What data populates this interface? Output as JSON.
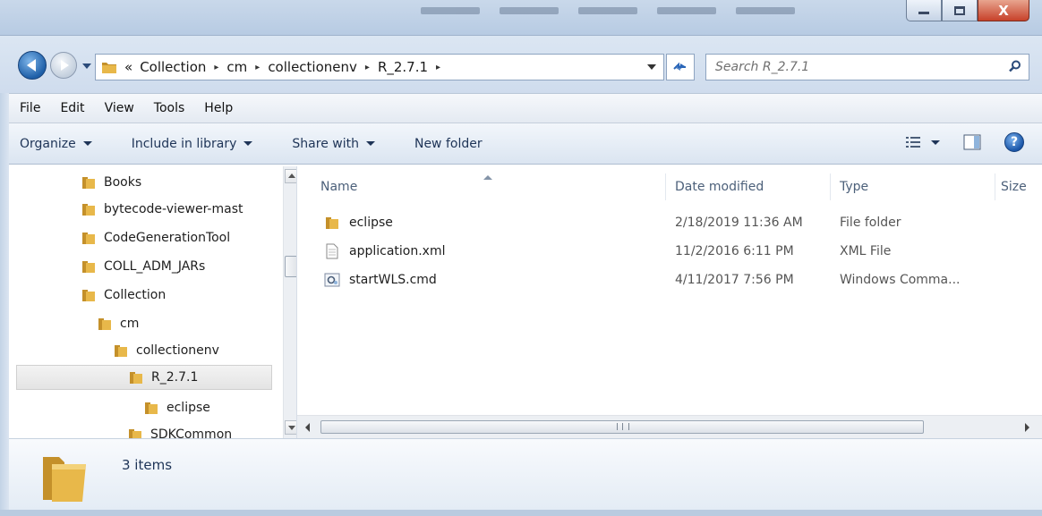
{
  "window": {
    "controls": {
      "minimize": "–",
      "maximize": "□",
      "close": "X"
    }
  },
  "address_bar": {
    "overflow": "«",
    "breadcrumbs": [
      "Collection",
      "cm",
      "collectionenv",
      "R_2.7.1"
    ],
    "separator": "▸"
  },
  "search": {
    "placeholder": "Search R_2.7.1"
  },
  "menu": [
    "File",
    "Edit",
    "View",
    "Tools",
    "Help"
  ],
  "toolbar": {
    "organize": "Organize",
    "include_in_library": "Include in library",
    "share_with": "Share with",
    "new_folder": "New folder"
  },
  "nav_tree": [
    {
      "label": "Books",
      "level": 0
    },
    {
      "label": "bytecode-viewer-mast",
      "level": 0
    },
    {
      "label": "CodeGenerationTool",
      "level": 0
    },
    {
      "label": "COLL_ADM_JARs",
      "level": 0
    },
    {
      "label": "Collection",
      "level": 0
    },
    {
      "label": "cm",
      "level": 1
    },
    {
      "label": "collectionenv",
      "level": 2
    },
    {
      "label": "R_2.7.1",
      "level": 3,
      "selected": true
    },
    {
      "label": "eclipse",
      "level": 4
    },
    {
      "label": "SDKCommon",
      "level": 3
    }
  ],
  "columns": {
    "name": "Name",
    "date_modified": "Date modified",
    "type": "Type",
    "size": "Size"
  },
  "files": [
    {
      "name": "eclipse",
      "date": "2/18/2019 11:36 AM",
      "type": "File folder",
      "icon": "folder-icon"
    },
    {
      "name": "application.xml",
      "date": "11/2/2016 6:11 PM",
      "type": "XML File",
      "icon": "xml-file-icon"
    },
    {
      "name": "startWLS.cmd",
      "date": "4/11/2017 7:56 PM",
      "type": "Windows Comma...",
      "icon": "cmd-file-icon"
    }
  ],
  "details": {
    "item_count": "3 items"
  },
  "colors": {
    "folder": "#e8b84a",
    "folder_dark": "#c4902a",
    "accent": "#1e5fa8"
  }
}
